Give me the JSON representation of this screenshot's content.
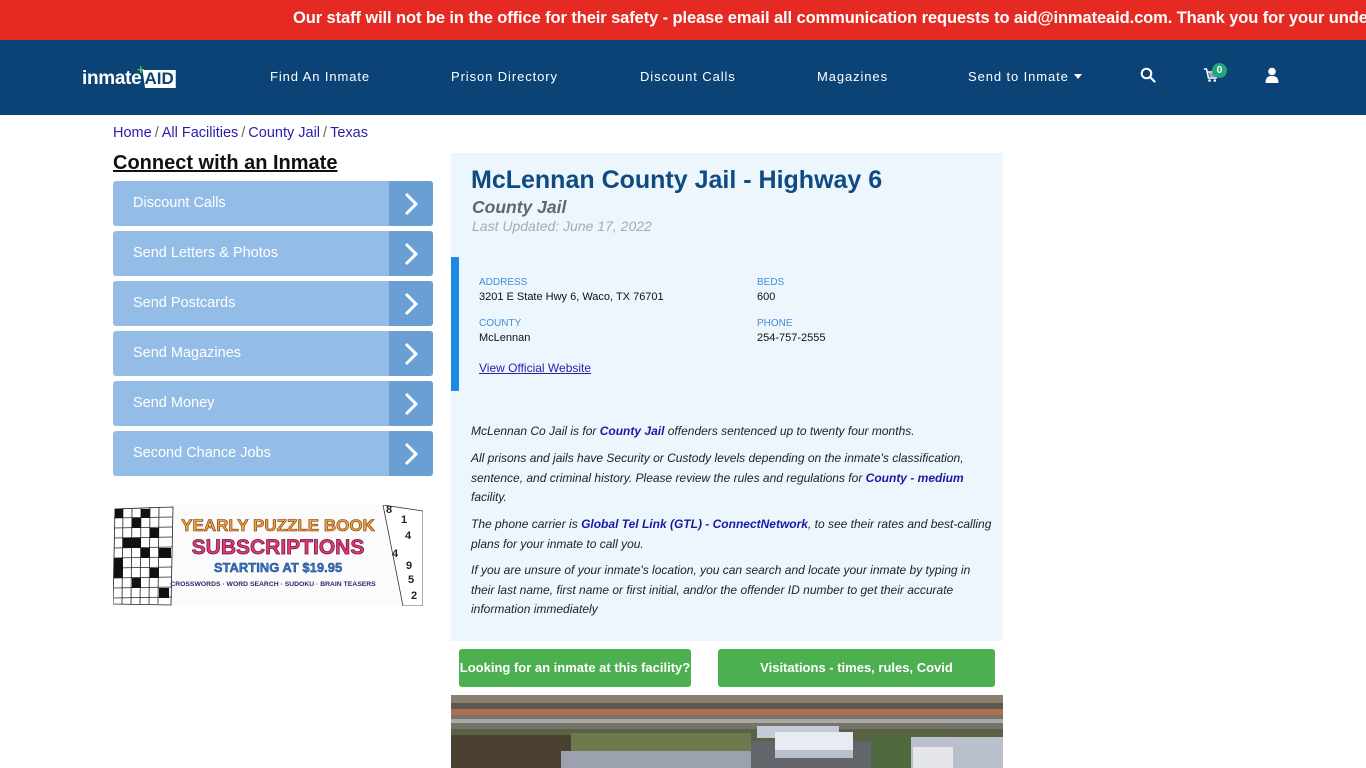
{
  "alert": {
    "text": "Our staff will not be in the office for their safety - please email all communication requests to aid@inmateaid.com. Thank you for your understanding."
  },
  "nav": {
    "logo_text": "inmate",
    "logo_aid": "AID",
    "logo_plus": "+",
    "links": [
      {
        "label": "Find An Inmate"
      },
      {
        "label": "Prison Directory"
      },
      {
        "label": "Discount Calls"
      },
      {
        "label": "Magazines"
      },
      {
        "label": "Send to Inmate"
      }
    ],
    "cart_count": "0",
    "icons": [
      "search-icon",
      "cart-icon",
      "user-icon"
    ]
  },
  "breadcrumb": {
    "items": [
      "Home",
      "All Facilities",
      "County Jail",
      "Texas"
    ],
    "separator": "/"
  },
  "sidebar": {
    "title": "Connect with an Inmate",
    "items": [
      {
        "label": "Discount Calls"
      },
      {
        "label": "Send Letters & Photos"
      },
      {
        "label": "Send Postcards"
      },
      {
        "label": "Send Magazines"
      },
      {
        "label": "Send Money"
      },
      {
        "label": "Second Chance Jobs"
      }
    ],
    "ad": {
      "line1": "YEARLY PUZZLE BOOK",
      "line2": "SUBSCRIPTIONS",
      "line3": "STARTING AT $19.95",
      "line4": "CROSSWORDS · WORD SEARCH · SUDOKU · BRAIN TEASERS",
      "sudoku_digits": [
        "8",
        "1",
        "4",
        "4",
        "9",
        "5",
        "2"
      ]
    }
  },
  "facility": {
    "title": "McLennan County Jail - Highway 6",
    "type": "County Jail",
    "last_updated": "Last Updated: June 17, 2022",
    "address_label": "ADDRESS",
    "address": "3201 E State Hwy 6, Waco, TX 76701",
    "beds_label": "BEDS",
    "beds": "600",
    "county_label": "COUNTY",
    "county": "McLennan",
    "phone_label": "PHONE",
    "phone": "254-757-2555",
    "website_link": "View Official Website",
    "accent_color": "#1e88e5"
  },
  "description": {
    "p1_pre": "McLennan Co Jail is for ",
    "p1_link": "County Jail",
    "p1_post": " offenders sentenced up to twenty four months.",
    "p2_pre": "All prisons and jails have Security or Custody levels depending on the inmate's classification, sentence, and criminal history. Please review the rules and regulations for ",
    "p2_link": "County - medium",
    "p2_post": " facility.",
    "p3_pre": "The phone carrier is ",
    "p3_link": "Global Tel Link (GTL) - ConnectNetwork",
    "p3_post": ", to see their rates and best-calling plans for your inmate to call you.",
    "p4": "If you are unsure of your inmate's location, you can search and locate your inmate by typing in their last name, first name or first initial, and/or the offender ID number to get their accurate information immediately"
  },
  "actions": {
    "find_inmate": "Looking for an inmate at this facility?",
    "visitations": "Visitations - times, rules, Covid cancellations"
  }
}
